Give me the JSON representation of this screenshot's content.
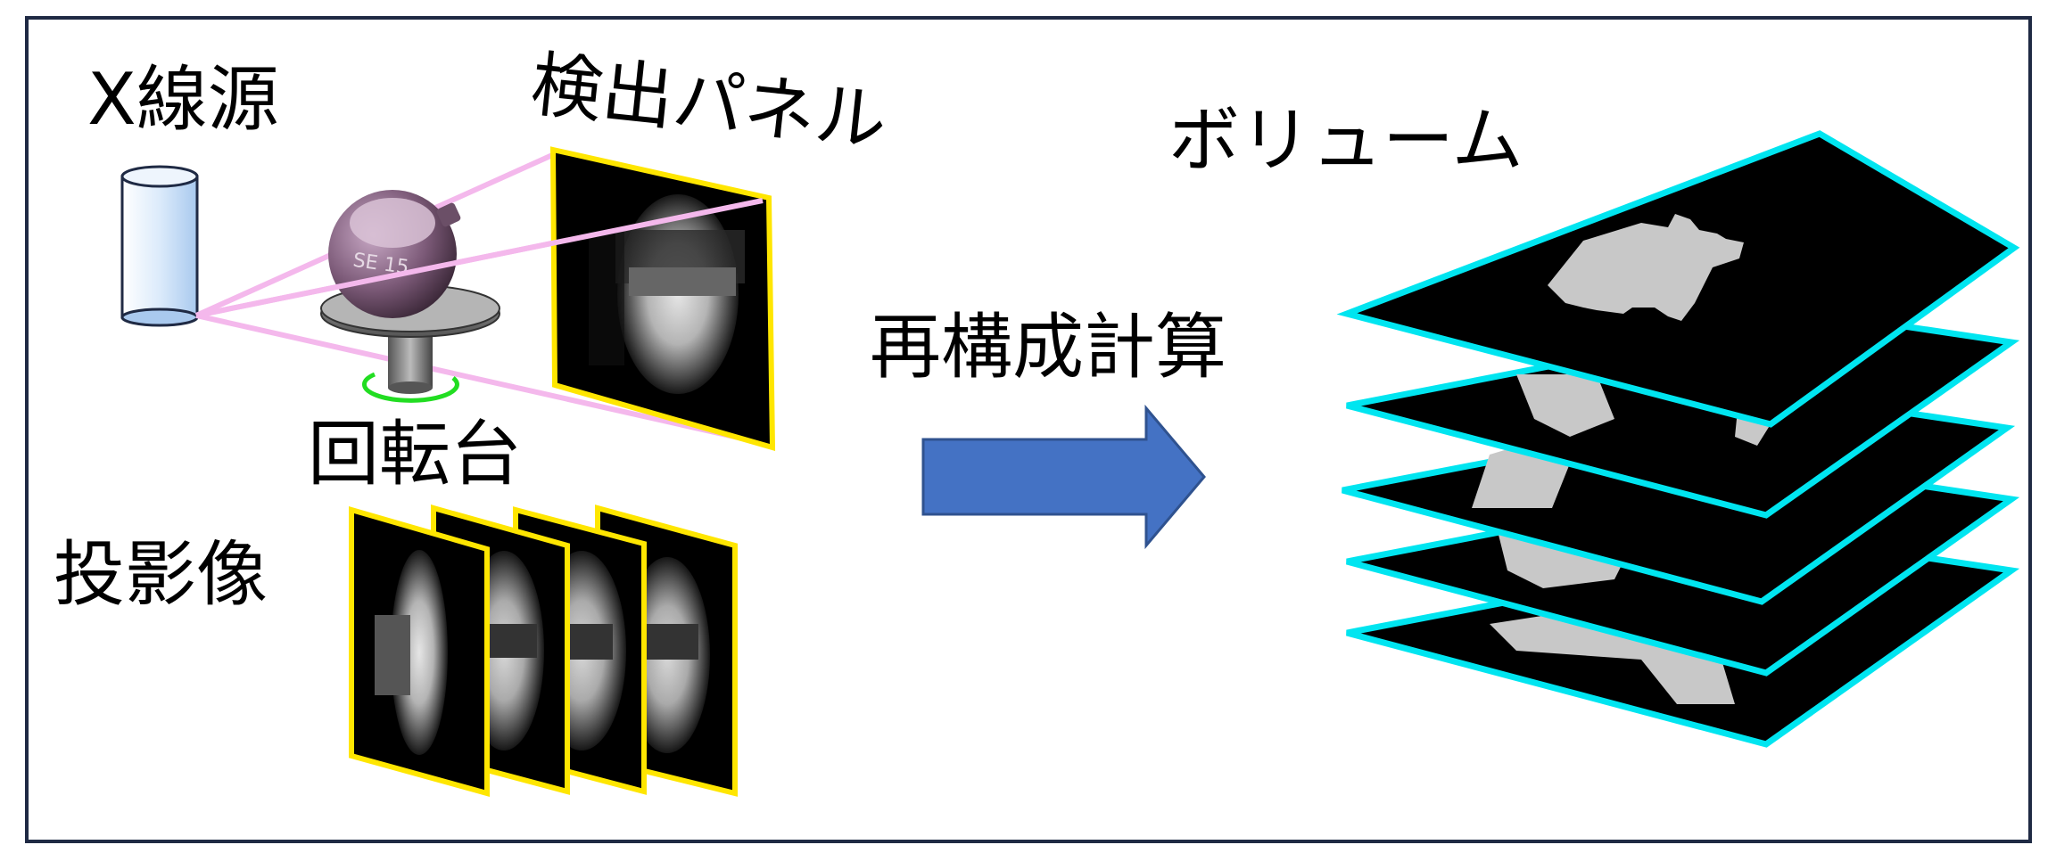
{
  "labels": {
    "xray_source": "X線源",
    "detector_panel": "検出パネル",
    "turntable": "回転台",
    "projections": "投影像",
    "reconstruction": "再構成計算",
    "volume": "ボリューム"
  },
  "colors": {
    "frame_border": "#1f2a44",
    "source_fill": "#cfe3f8",
    "beam": "#f4b8ec",
    "panel_border": "#ffe600",
    "rotation_ring": "#22dd22",
    "arrow_fill": "#4472c4",
    "arrow_stroke": "#2f528f",
    "slice_border": "#00e5f0",
    "slice_shape": "#c8c8c8"
  },
  "icons": {
    "source": "cylinder-icon",
    "rotation": "rotation-arrow-icon",
    "process": "right-arrow-icon"
  }
}
